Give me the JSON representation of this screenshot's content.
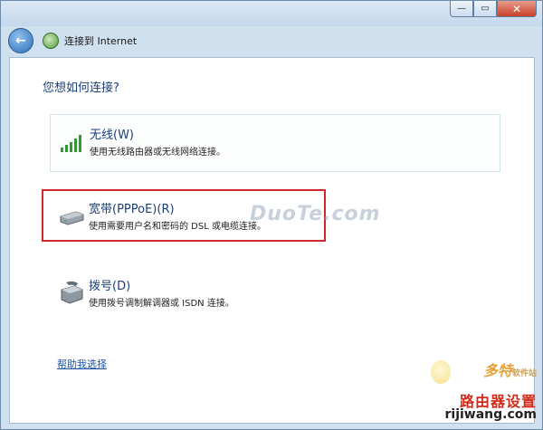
{
  "window": {
    "title": "连接到 Internet",
    "min_label": "—",
    "max_label": "▭",
    "close_label": "✕",
    "back_label": "←"
  },
  "question": "您想如何连接?",
  "options": [
    {
      "title": "无线(W)",
      "description": "使用无线路由器或无线网络连接。",
      "icon": "wireless-signal-icon"
    },
    {
      "title": "宽带(PPPoE)(R)",
      "description": "使用需要用户名和密码的 DSL 或电缆连接。",
      "icon": "broadband-modem-icon"
    },
    {
      "title": "拨号(D)",
      "description": "使用拨号调制解调器或 ISDN 连接。",
      "icon": "dialup-modem-icon"
    }
  ],
  "help_link": "帮助我选择",
  "watermarks": {
    "center": "DuoTe.com",
    "brand": "多特",
    "brand_sub": "软件站",
    "router_site": "路由器设置",
    "url": "rijiwang.com"
  },
  "colors": {
    "title_blue": "#1c3f78",
    "highlight_red": "#d1282e",
    "link_blue": "#1c52a8"
  }
}
